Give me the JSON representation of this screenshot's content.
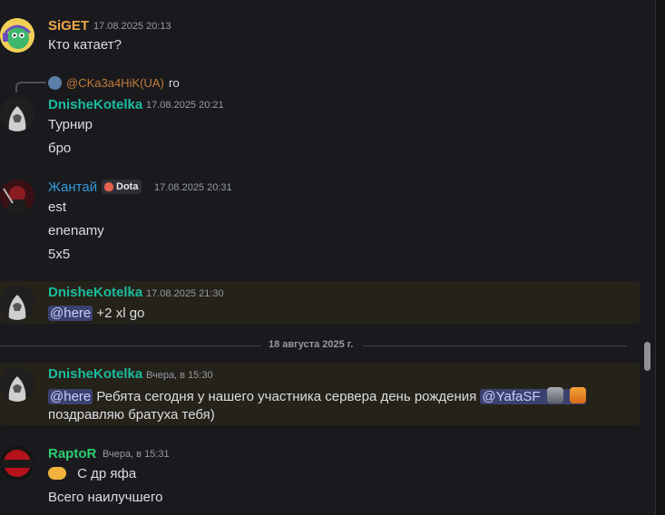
{
  "messages": [
    {
      "author": "SiGET",
      "timestamp": "17.08.2025 20:13",
      "lines": [
        "Кто катает?"
      ]
    },
    {
      "reply": {
        "to": "@CKa3a4HiK(UA)",
        "text": "го"
      },
      "author": "DnisheKotelka",
      "timestamp": "17.08.2025 20:21",
      "lines": [
        "Турнир",
        "бро"
      ]
    },
    {
      "author": "Жантай",
      "tag": "Dota",
      "timestamp": "17.08.2025 20:31",
      "lines": [
        "est",
        "enenamy",
        "5x5"
      ]
    },
    {
      "author": "DnisheKotelka",
      "timestamp": "17.08.2025 21:30",
      "mention": "@here",
      "text": "+2 xl go"
    }
  ],
  "divider": {
    "label": "18 августа 2025 г."
  },
  "later": [
    {
      "author": "DnisheKotelka",
      "timestamp": "Вчера, в 15:30",
      "mention": "@here",
      "text": "Ребята сегодня у нашего участника сервера день рождения",
      "mention2": "@YafaSF",
      "line2": "поздравляю братуха тебя)"
    },
    {
      "author": "RaptoR",
      "timestamp": "Вчера, в 15:31",
      "lines": [
        "С др яфа",
        "Всего наилучшего"
      ]
    }
  ],
  "icons": {
    "reply": "reply-arrow-icon",
    "handshake": "handshake-emoji",
    "wolf": "wolf-emoji",
    "tiger": "tiger-emoji"
  },
  "colors": {
    "siget": "#f0a848",
    "dnishe": "#1abc9c",
    "zhantai": "#3498db",
    "raptor": "#2ecc71"
  }
}
